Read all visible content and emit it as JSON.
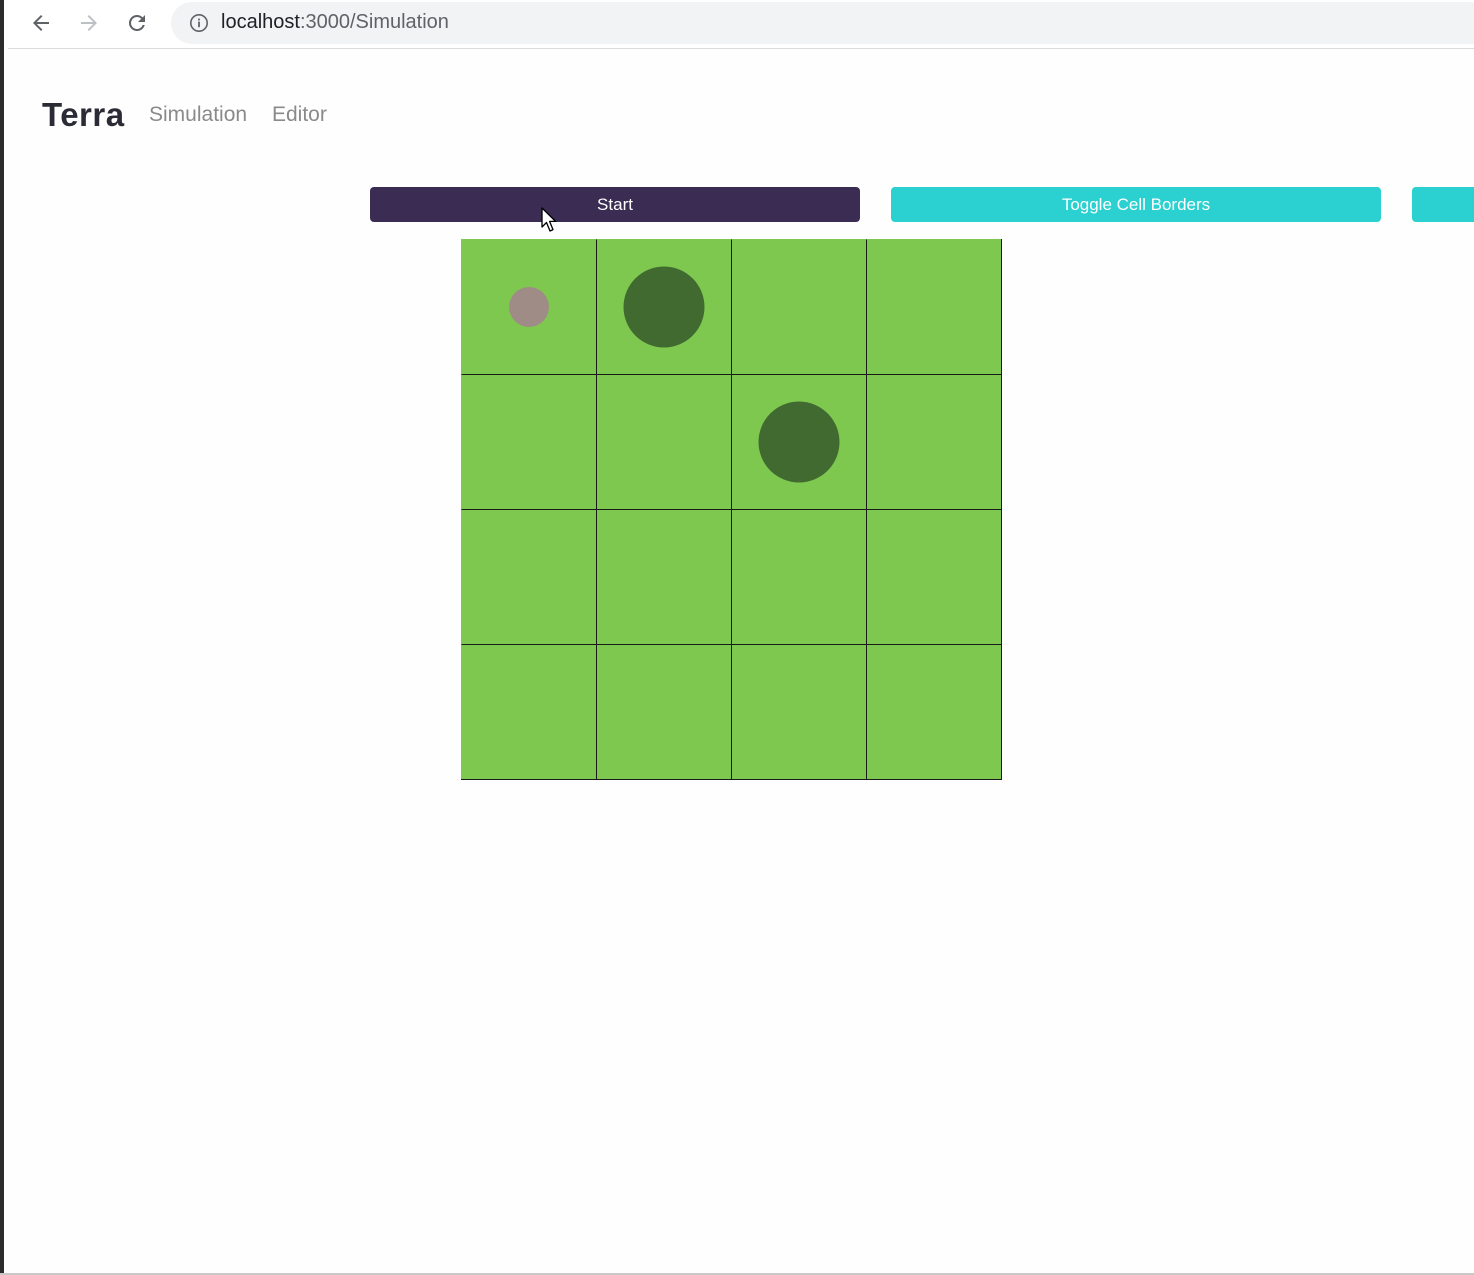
{
  "browser": {
    "url_host": "localhost",
    "url_path": ":3000/Simulation",
    "back_icon": "arrow-left-icon",
    "forward_icon": "arrow-right-icon",
    "reload_icon": "reload-icon",
    "info_icon": "info-icon"
  },
  "header": {
    "brand": "Terra",
    "nav": [
      {
        "label": "Simulation"
      },
      {
        "label": "Editor"
      }
    ]
  },
  "controls": {
    "start_label": "Start",
    "toggle_borders_label": "Toggle Cell Borders",
    "third_label": "",
    "start_color": "#3a2c52",
    "accent_color": "#2bd0d0"
  },
  "grid": {
    "rows": 4,
    "cols": 4,
    "cell_color": "#7ec850",
    "border_color": "#1a1a1a",
    "creatures": [
      {
        "row": 0,
        "col": 0,
        "type": "small",
        "color": "#a08c86"
      },
      {
        "row": 0,
        "col": 1,
        "type": "large",
        "color": "#406a30"
      },
      {
        "row": 1,
        "col": 2,
        "type": "large",
        "color": "#406a30"
      }
    ]
  }
}
